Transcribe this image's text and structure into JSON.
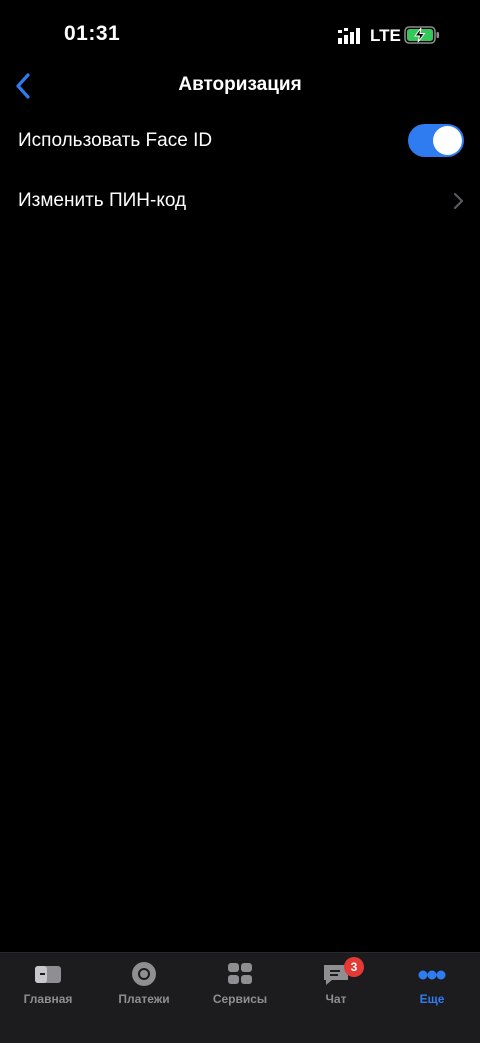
{
  "status_bar": {
    "time": "01:31",
    "network": "LTE"
  },
  "nav": {
    "title": "Авторизация"
  },
  "settings": {
    "face_id": {
      "label": "Использовать Face ID",
      "enabled": true
    },
    "pin": {
      "label": "Изменить ПИН-код"
    }
  },
  "tabbar": {
    "items": [
      {
        "label": "Главная",
        "icon": "card-icon",
        "active": false
      },
      {
        "label": "Платежи",
        "icon": "circle-icon",
        "active": false
      },
      {
        "label": "Сервисы",
        "icon": "grid-icon",
        "active": false
      },
      {
        "label": "Чат",
        "icon": "chat-icon",
        "active": false,
        "badge": "3"
      },
      {
        "label": "Еще",
        "icon": "more-dots-icon",
        "active": true
      }
    ]
  },
  "colors": {
    "accent": "#2f7bf0",
    "background": "#000000",
    "tabbar_bg": "#1c1c1e",
    "inactive": "#8e8e93",
    "badge": "#e53935",
    "battery_charge": "#34c759"
  }
}
